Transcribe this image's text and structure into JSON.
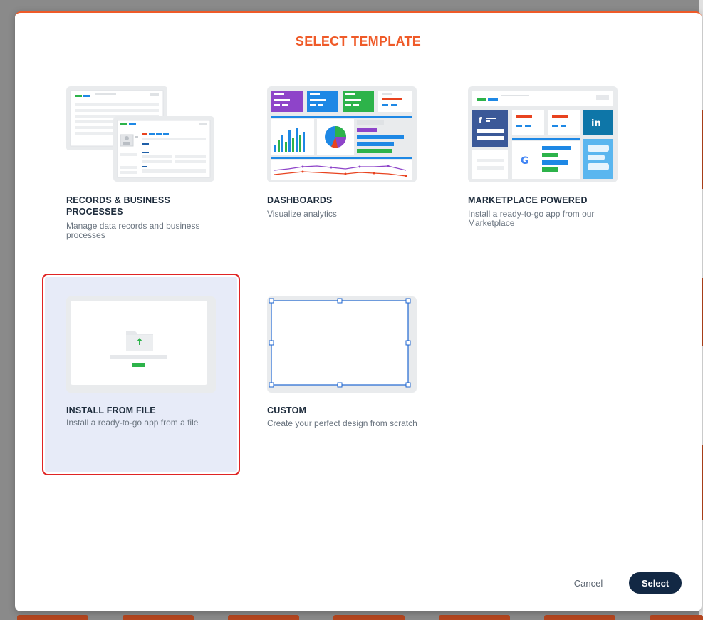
{
  "modal": {
    "title": "SELECT TEMPLATE"
  },
  "templates": [
    {
      "id": "records",
      "title": "RECORDS & BUSINESS PROCESSES",
      "description": "Manage data records and business processes",
      "selected": false
    },
    {
      "id": "dashboards",
      "title": "DASHBOARDS",
      "description": "Visualize analytics",
      "selected": false
    },
    {
      "id": "marketplace",
      "title": "MARKETPLACE POWERED",
      "description": "Install a ready-to-go app from our Marketplace",
      "selected": false
    },
    {
      "id": "install-file",
      "title": "INSTALL FROM FILE",
      "description": "Install a ready-to-go app from a file",
      "selected": true
    },
    {
      "id": "custom",
      "title": "CUSTOM",
      "description": "Create your perfect design from scratch",
      "selected": false
    }
  ],
  "thumb_labels": {
    "facebook": "f",
    "linkedin": "in",
    "google": "G"
  },
  "footer": {
    "cancel_label": "Cancel",
    "select_label": "Select"
  },
  "colors": {
    "accent": "#ef5a28",
    "primary_button": "#122844",
    "selected_bg": "#e7ebf8",
    "selected_outline": "#e02424",
    "green": "#2db34a",
    "blue": "#1e88e5",
    "purple": "#8e44c9",
    "red": "#e8431f"
  }
}
